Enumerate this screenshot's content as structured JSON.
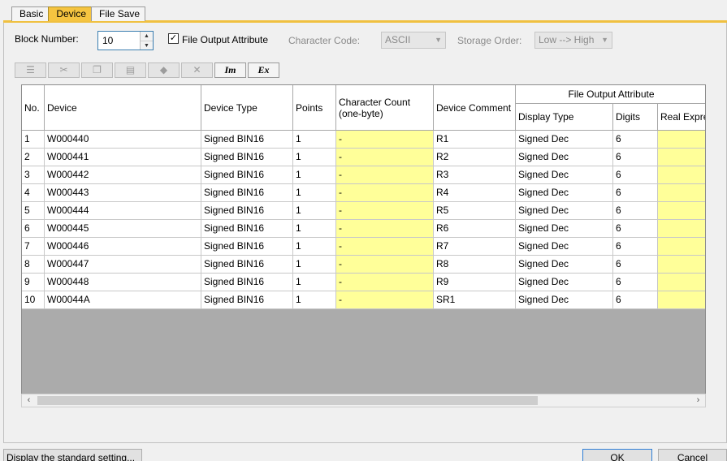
{
  "tabs": [
    "Basic",
    "Device",
    "File Save"
  ],
  "form": {
    "block_number_label": "Block Number:",
    "block_number_value": "10",
    "file_output_attribute_label": "File Output Attribute",
    "file_output_attribute_checked": true,
    "character_code_label": "Character Code:",
    "character_code_value": "ASCII",
    "storage_order_label": "Storage Order:",
    "storage_order_value": "Low --> High"
  },
  "toolbar": {
    "icons": [
      "insert-row-icon",
      "cut-icon",
      "copy-icon",
      "paste-icon",
      "eraser-icon",
      "delete-icon",
      "import-icon",
      "export-icon"
    ],
    "im_label": "Im",
    "ex_label": "Ex"
  },
  "table": {
    "headers": {
      "no": "No.",
      "device": "Device",
      "device_type": "Device Type",
      "points": "Points",
      "character_count": "Character Count (one-byte)",
      "device_comment": "Device Comment",
      "file_output_attribute": "File Output Attribute",
      "display_type": "Display Type",
      "digits": "Digits",
      "real_expression": "Real Expre"
    },
    "rows": [
      {
        "no": "1",
        "device": "W000440",
        "device_type": "Signed BIN16",
        "points": "1",
        "char_count": "-",
        "comment": "R1",
        "display_type": "Signed Dec",
        "digits": "6"
      },
      {
        "no": "2",
        "device": "W000441",
        "device_type": "Signed BIN16",
        "points": "1",
        "char_count": "-",
        "comment": "R2",
        "display_type": "Signed Dec",
        "digits": "6"
      },
      {
        "no": "3",
        "device": "W000442",
        "device_type": "Signed BIN16",
        "points": "1",
        "char_count": "-",
        "comment": "R3",
        "display_type": "Signed Dec",
        "digits": "6"
      },
      {
        "no": "4",
        "device": "W000443",
        "device_type": "Signed BIN16",
        "points": "1",
        "char_count": "-",
        "comment": "R4",
        "display_type": "Signed Dec",
        "digits": "6"
      },
      {
        "no": "5",
        "device": "W000444",
        "device_type": "Signed BIN16",
        "points": "1",
        "char_count": "-",
        "comment": "R5",
        "display_type": "Signed Dec",
        "digits": "6"
      },
      {
        "no": "6",
        "device": "W000445",
        "device_type": "Signed BIN16",
        "points": "1",
        "char_count": "-",
        "comment": "R6",
        "display_type": "Signed Dec",
        "digits": "6"
      },
      {
        "no": "7",
        "device": "W000446",
        "device_type": "Signed BIN16",
        "points": "1",
        "char_count": "-",
        "comment": "R7",
        "display_type": "Signed Dec",
        "digits": "6"
      },
      {
        "no": "8",
        "device": "W000447",
        "device_type": "Signed BIN16",
        "points": "1",
        "char_count": "-",
        "comment": "R8",
        "display_type": "Signed Dec",
        "digits": "6"
      },
      {
        "no": "9",
        "device": "W000448",
        "device_type": "Signed BIN16",
        "points": "1",
        "char_count": "-",
        "comment": "R9",
        "display_type": "Signed Dec",
        "digits": "6"
      },
      {
        "no": "10",
        "device": "W00044A",
        "device_type": "Signed BIN16",
        "points": "1",
        "char_count": "-",
        "comment": "SR1",
        "display_type": "Signed Dec",
        "digits": "6"
      }
    ]
  },
  "buttons": {
    "display_standard": "Display the standard setting...",
    "ok": "OK",
    "cancel": "Cancel"
  },
  "colors": {
    "active_tab": "#f5c440",
    "highlight_cell": "#ffff99",
    "grid_empty": "#ababab"
  }
}
